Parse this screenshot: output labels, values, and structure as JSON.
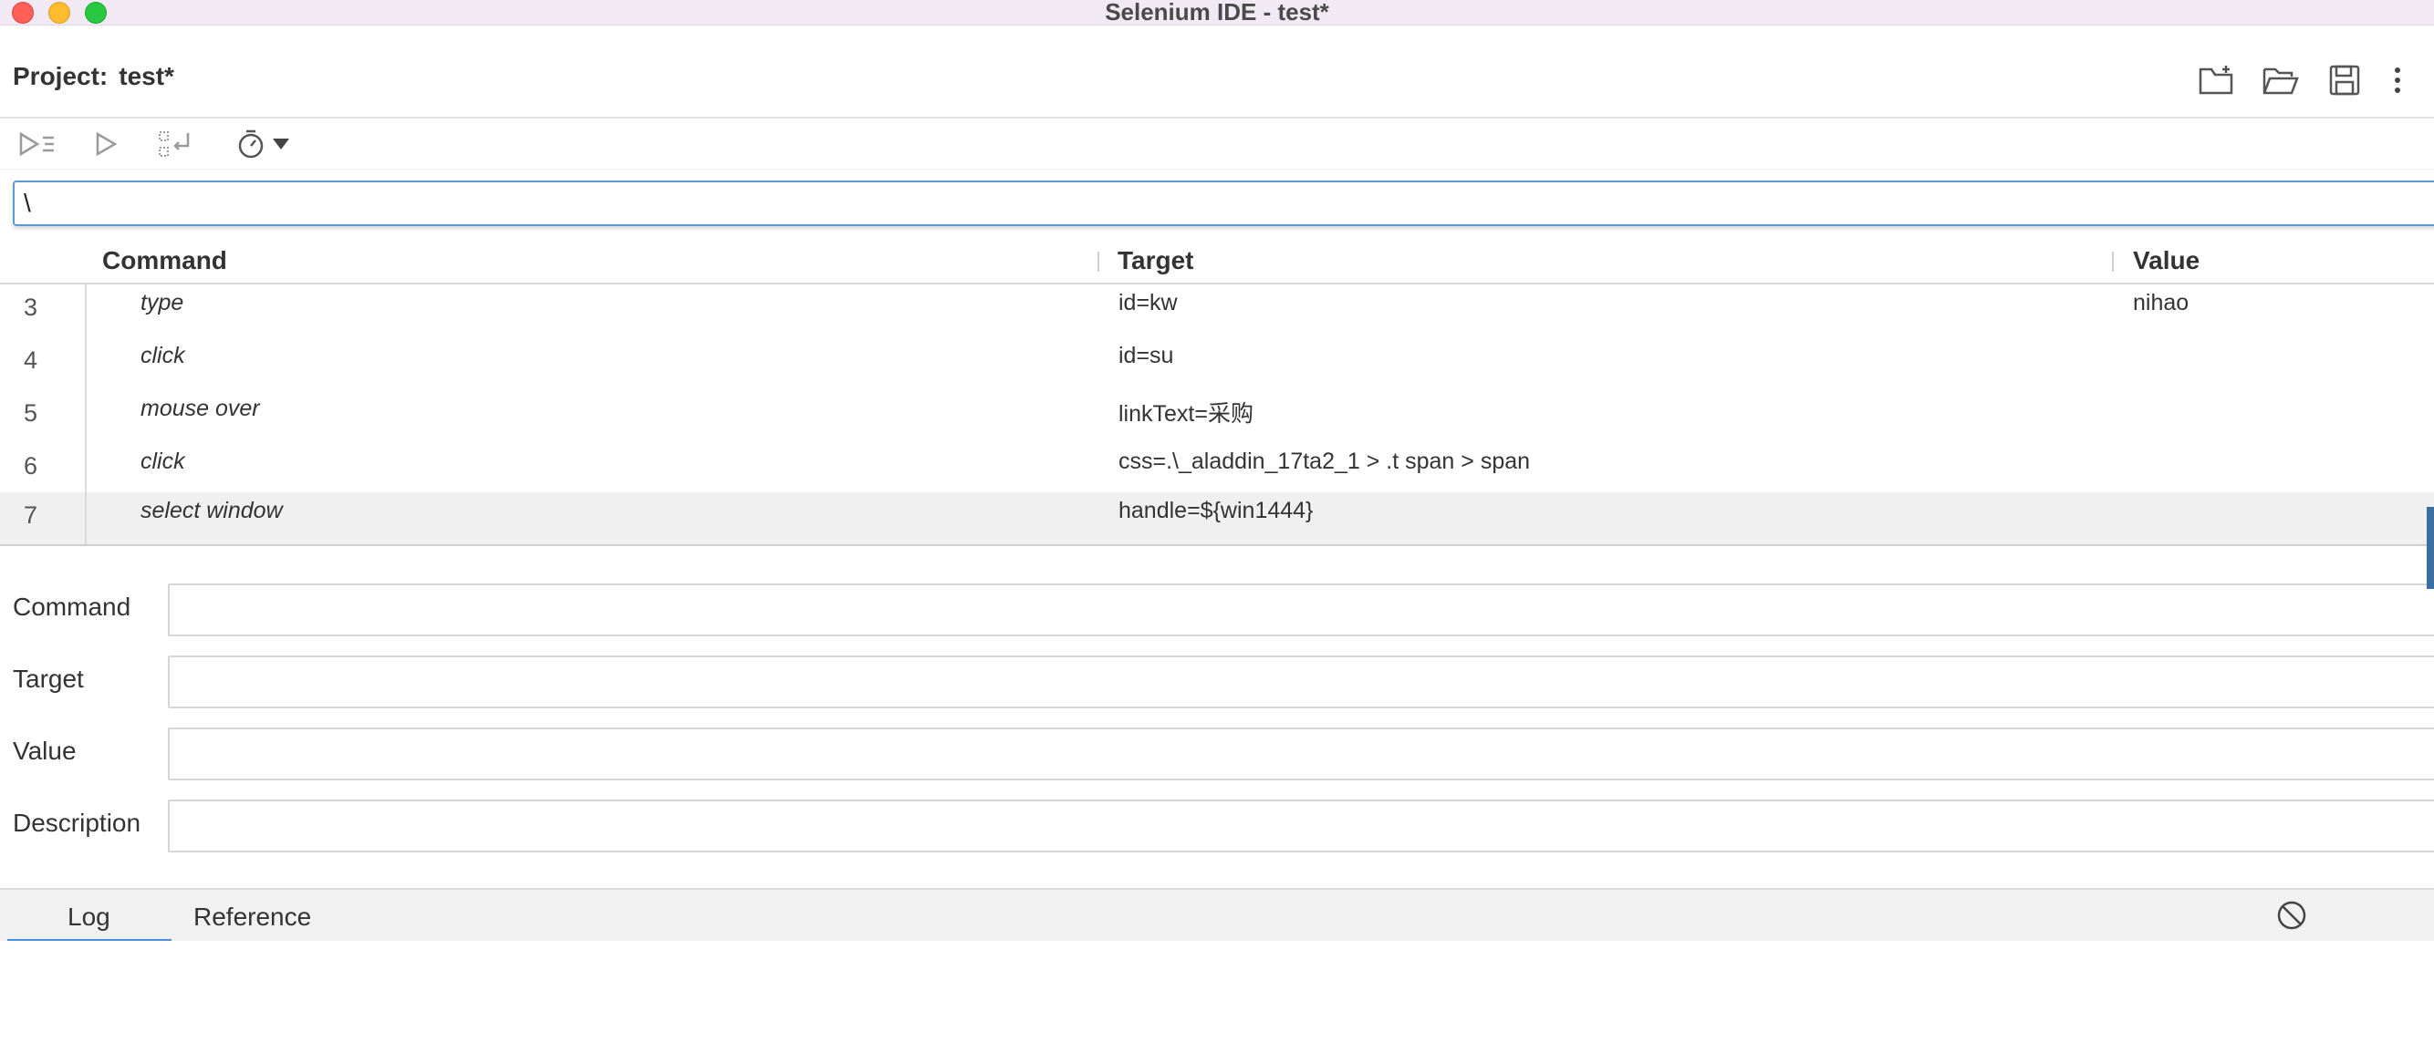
{
  "window": {
    "title": "Selenium IDE - test*"
  },
  "header": {
    "project_label": "Project:",
    "project_name": "test*",
    "icons": [
      "new-project-icon",
      "open-project-icon",
      "save-project-icon",
      "more-options-icon"
    ]
  },
  "toolbar": {
    "icons": [
      "run-all-tests-icon",
      "run-current-test-icon",
      "step-over-icon",
      "speed-timer-icon",
      "dropdown-arrow-icon"
    ]
  },
  "search": {
    "value": "\\"
  },
  "grid": {
    "columns": {
      "command": "Command",
      "target": "Target",
      "value": "Value"
    },
    "rows": [
      {
        "num": "3",
        "command": "type",
        "target": "id=kw",
        "value": "nihao"
      },
      {
        "num": "4",
        "command": "click",
        "target": "id=su",
        "value": ""
      },
      {
        "num": "5",
        "command": "mouse over",
        "target": "linkText=采购",
        "value": ""
      },
      {
        "num": "6",
        "command": "click",
        "target": "css=.\\_aladdin_17ta2_1 > .t span > span",
        "value": ""
      },
      {
        "num": "7",
        "command": "select window",
        "target": "handle=${win1444}",
        "value": ""
      }
    ],
    "selected_row": "7"
  },
  "editor": {
    "command_label": "Command",
    "target_label": "Target",
    "value_label": "Value",
    "description_label": "Description",
    "command_value": "",
    "target_value": "",
    "value_value": "",
    "description_value": ""
  },
  "log": {
    "tabs": [
      "Log",
      "Reference"
    ],
    "active_tab": "Log",
    "clear_icon": "clear-log-icon"
  },
  "colors": {
    "accent": "#4a90e2",
    "titlebar": "#f1e9f3",
    "selected_row": "#f0f0f0"
  }
}
